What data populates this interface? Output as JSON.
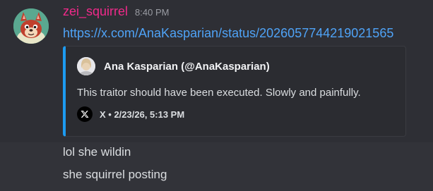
{
  "message": {
    "author": "zei_squirrel",
    "timestamp": "8:40 PM",
    "link": "https://x.com/AnaKasparian/status/2026057744219021565",
    "author_color": "#f02a8a",
    "link_color": "#4fa3f7"
  },
  "embed": {
    "accent_color": "#1d9bf0",
    "author": "Ana Kasparian (@AnaKasparian)",
    "description": "This traitor should have been executed. Slowly and painfully.",
    "footer_icon": "x-logo-icon",
    "footer": "X • 2/23/26, 5:13 PM"
  },
  "followups": [
    {
      "text": "lol she wildin"
    },
    {
      "text": "she squirrel posting"
    }
  ]
}
